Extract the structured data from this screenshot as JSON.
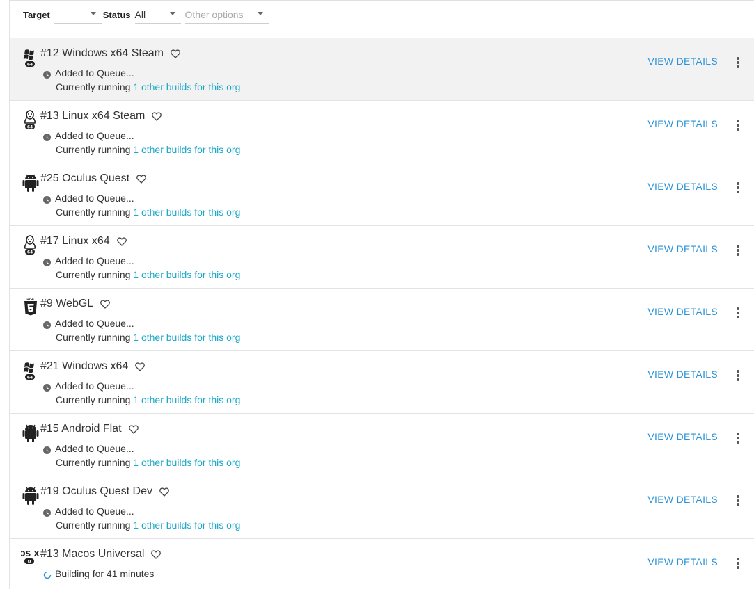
{
  "filters": {
    "target_label": "Target",
    "target_value": "",
    "status_label": "Status",
    "status_value": "All",
    "other_placeholder": "Other options"
  },
  "builds": [
    {
      "platform": "windows",
      "badge": "64",
      "title": "#12 Windows x64 Steam",
      "status": "Added to Queue...",
      "running_prefix": "Currently running",
      "running_link": "1 other builds for this org",
      "action": "VIEW DETAILS",
      "selected": true
    },
    {
      "platform": "linux",
      "badge": "64",
      "title": "#13 Linux x64 Steam",
      "status": "Added to Queue...",
      "running_prefix": "Currently running",
      "running_link": "1 other builds for this org",
      "action": "VIEW DETAILS"
    },
    {
      "platform": "android",
      "badge": "",
      "title": "#25 Oculus Quest",
      "status": "Added to Queue...",
      "running_prefix": "Currently running",
      "running_link": "1 other builds for this org",
      "action": "VIEW DETAILS"
    },
    {
      "platform": "linux",
      "badge": "64",
      "title": "#17 Linux x64",
      "status": "Added to Queue...",
      "running_prefix": "Currently running",
      "running_link": "1 other builds for this org",
      "action": "VIEW DETAILS"
    },
    {
      "platform": "html5",
      "badge": "",
      "title": "#9 WebGL",
      "status": "Added to Queue...",
      "running_prefix": "Currently running",
      "running_link": "1 other builds for this org",
      "action": "VIEW DETAILS"
    },
    {
      "platform": "windows",
      "badge": "64",
      "title": "#21 Windows x64",
      "status": "Added to Queue...",
      "running_prefix": "Currently running",
      "running_link": "1 other builds for this org",
      "action": "VIEW DETAILS"
    },
    {
      "platform": "android",
      "badge": "",
      "title": "#15 Android Flat",
      "status": "Added to Queue...",
      "running_prefix": "Currently running",
      "running_link": "1 other builds for this org",
      "action": "VIEW DETAILS"
    },
    {
      "platform": "android",
      "badge": "",
      "title": "#19 Oculus Quest Dev",
      "status": "Added to Queue...",
      "running_prefix": "Currently running",
      "running_link": "1 other builds for this org",
      "action": "VIEW DETAILS"
    },
    {
      "platform": "osx",
      "badge": "U",
      "platform_text": "OS X",
      "title": "#13 Macos Universal",
      "status": "Building for 41 minutes",
      "status_kind": "building",
      "action": "VIEW DETAILS"
    }
  ],
  "colors": {
    "link": "#1ba8c9",
    "action": "#2b93d8",
    "selected_row": "#f2f2f2"
  }
}
